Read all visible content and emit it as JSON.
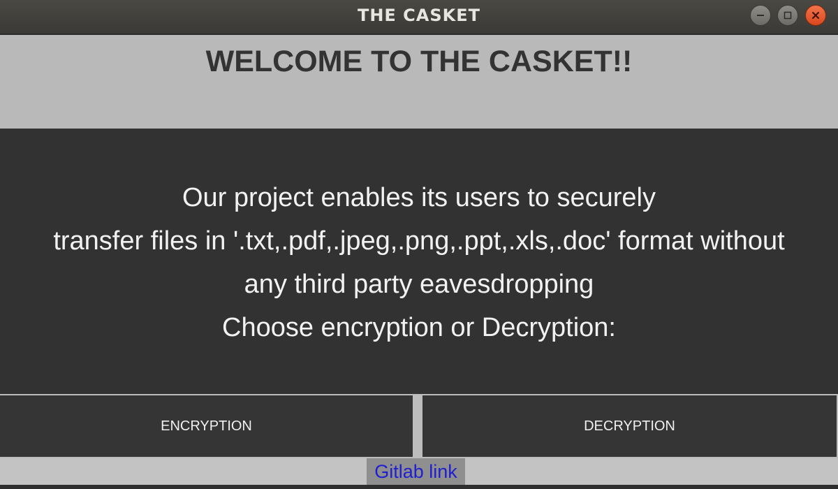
{
  "window": {
    "title": "THE CASKET"
  },
  "header": {
    "welcome": "WELCOME TO THE CASKET!!"
  },
  "description": {
    "lines": [
      "Our project enables its users to securely",
      "transfer files in '.txt,.pdf,.jpeg,.png,.ppt,.xls,.doc' format without",
      "any third party eavesdropping",
      "Choose encryption or Decryption:"
    ]
  },
  "actions": {
    "encryption_label": "ENCRYPTION",
    "decryption_label": "DECRYPTION"
  },
  "footer": {
    "link_label": "Gitlab link"
  },
  "icons": {
    "minimize": "minimize-icon",
    "maximize": "maximize-icon",
    "close": "close-icon"
  },
  "colors": {
    "titlebar": "#3f3e3a",
    "welcome_band": "#b9b9b9",
    "content_bg": "#323232",
    "button_bg": "#353535",
    "close_button": "#e55a2a",
    "link_text": "#1f1fcf"
  }
}
